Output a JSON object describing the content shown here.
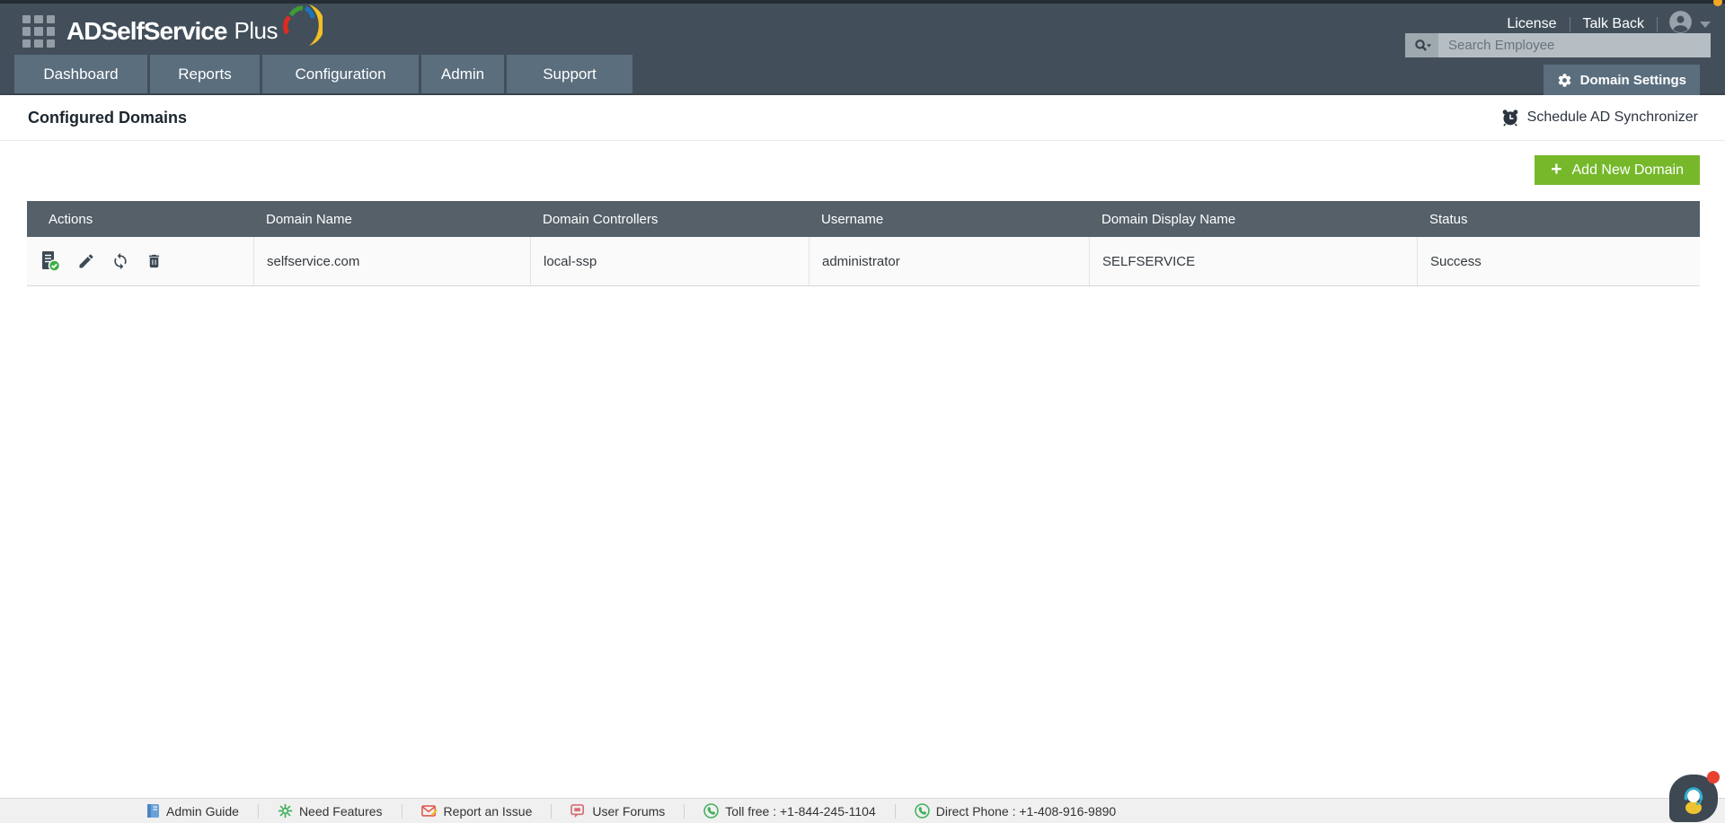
{
  "header": {
    "brand_bold": "ADSelfService",
    "brand_light": "Plus",
    "top_links": {
      "license": "License",
      "talk_back": "Talk Back"
    },
    "search": {
      "placeholder": "Search Employee",
      "value": ""
    },
    "tabs": [
      {
        "label": "Dashboard"
      },
      {
        "label": "Reports"
      },
      {
        "label": "Configuration"
      },
      {
        "label": "Admin"
      },
      {
        "label": "Support"
      }
    ],
    "domain_settings_label": "Domain Settings"
  },
  "page": {
    "title": "Configured Domains",
    "schedule_link": "Schedule AD Synchronizer",
    "add_button": "Add New Domain"
  },
  "table": {
    "columns": [
      "Actions",
      "Domain Name",
      "Domain Controllers",
      "Username",
      "Domain Display Name",
      "Status"
    ],
    "action_icons": [
      "domain-details-verified",
      "edit",
      "sync",
      "delete"
    ],
    "rows": [
      {
        "domain_name": "selfservice.com",
        "domain_controllers": "local-ssp",
        "username": "administrator",
        "display_name": "SELFSERVICE",
        "status": "Success"
      }
    ]
  },
  "footer": {
    "items": [
      {
        "label": "Admin Guide"
      },
      {
        "label": "Need Features"
      },
      {
        "label": "Report an Issue"
      },
      {
        "label": "User Forums"
      },
      {
        "label": "Toll free : +1-844-245-1104"
      },
      {
        "label": "Direct Phone : +1-408-916-9890"
      }
    ]
  },
  "colors": {
    "header_bg": "#424f5a",
    "tab_bg": "#5a6e7d",
    "table_header_bg": "#556069",
    "accent_green": "#76b82a",
    "notification_red": "#e8412f",
    "notification_orange": "#f5a623"
  }
}
